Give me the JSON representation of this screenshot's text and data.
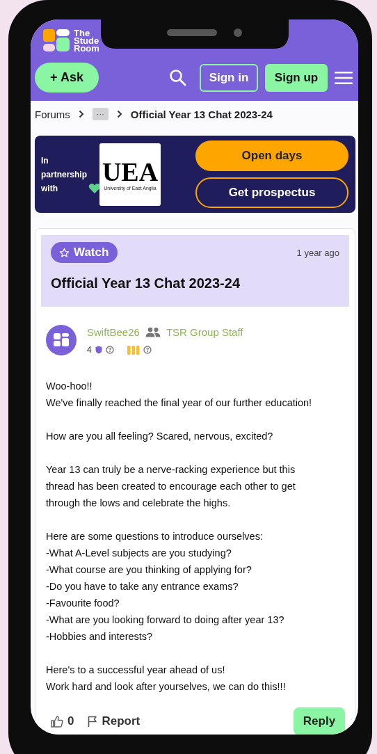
{
  "logo": {
    "lines": [
      "The",
      "Stude",
      "Room"
    ]
  },
  "header": {
    "ask": "+ Ask",
    "sign_in": "Sign in",
    "sign_up": "Sign up"
  },
  "breadcrumb": {
    "items": [
      "Forums",
      "···",
      "Official Year 13 Chat 2023-24"
    ]
  },
  "banner": {
    "partner_text": "In partnership with",
    "logo_mark": "UEA",
    "logo_caption": "University of East Anglia",
    "buttons": [
      "Open days",
      "Get prospectus"
    ]
  },
  "thread": {
    "watch": "Watch",
    "age": "1 year ago",
    "title": "Official Year 13 Chat 2023-24"
  },
  "post": {
    "author": "SwiftBee26",
    "group": "TSR Group Staff",
    "reputation": "4",
    "paragraphs": [
      "Woo-hoo!!\nWe've finally reached the final year of our further education!",
      "How are you all feeling? Scared, nervous, excited?",
      "Year 13 can truly be a nerve-racking experience but this thread has been created to encourage each other to get through the lows and celebrate the highs.",
      "Here are some questions to introduce ourselves:\n-What A-Level subjects are you studying?\n-What course are you thinking of applying for?\n-Do you have to take any entrance exams?\n-Favourite food?\n-What are you looking forward to doing after year 13?\n-Hobbies and interests?",
      "Here's to a successful year ahead of us!\nWork hard and look after yourselves, we can do this!!!"
    ],
    "likes": "0",
    "report": "Report",
    "reply": "Reply"
  }
}
